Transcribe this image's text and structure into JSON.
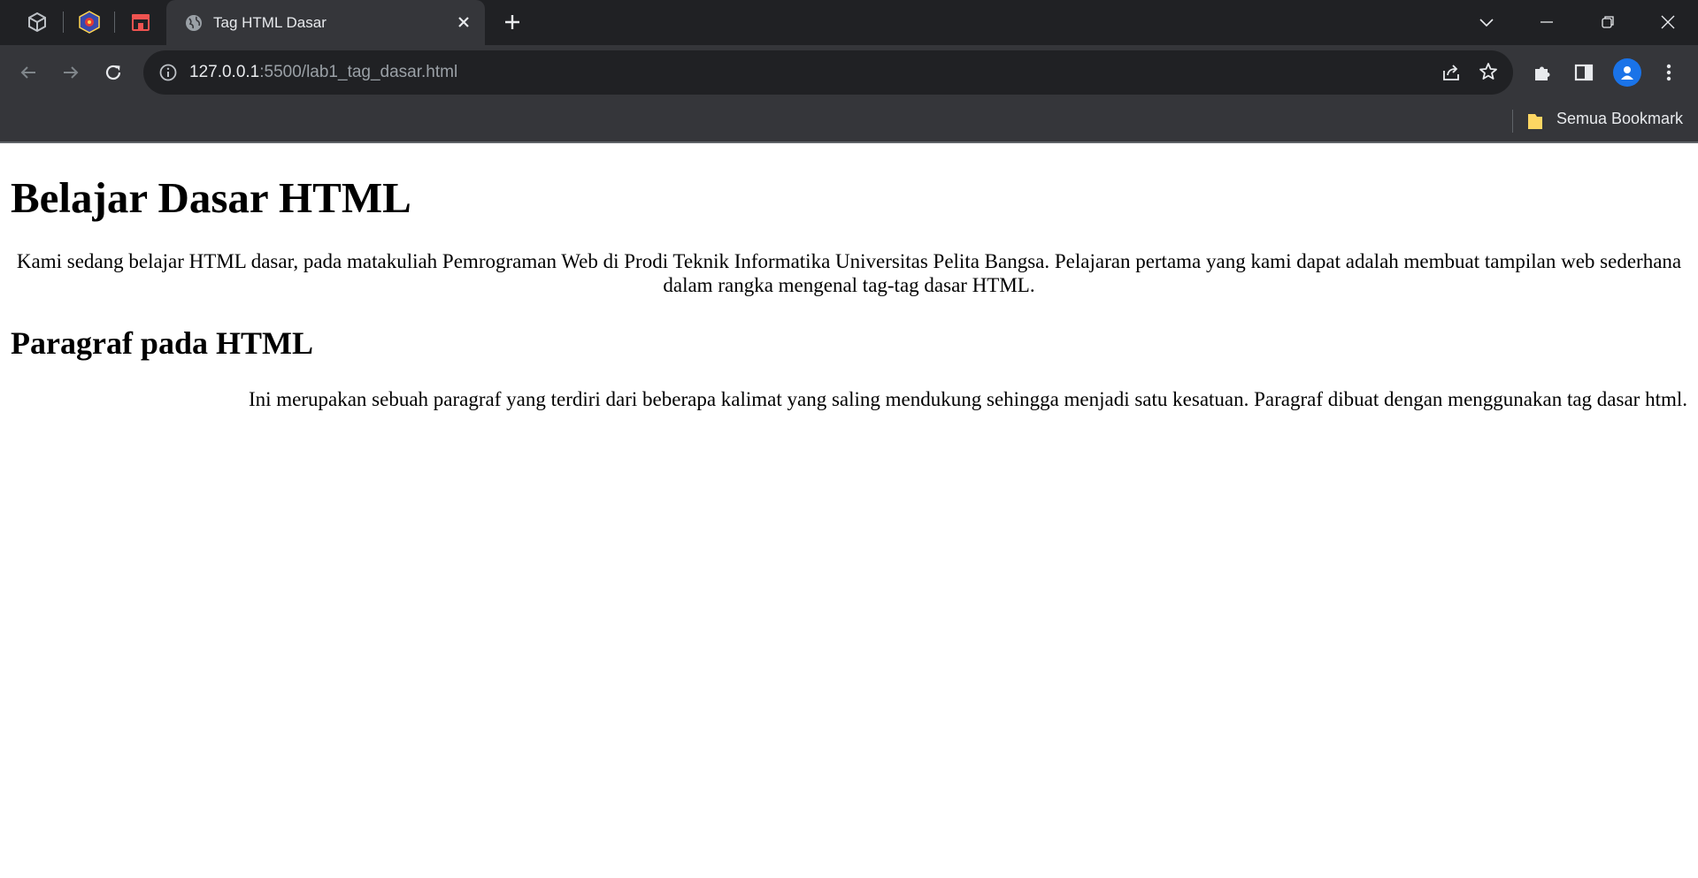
{
  "browser": {
    "pinned_tabs": [
      {
        "icon": "cube-icon"
      },
      {
        "icon": "university-crest-icon"
      },
      {
        "icon": "store-icon"
      }
    ],
    "active_tab": {
      "title": "Tag HTML Dasar",
      "icon": "globe-icon"
    },
    "address": {
      "host": "127.0.0.1",
      "rest": ":5500/lab1_tag_dasar.html"
    },
    "bookmarks": {
      "all_label": "Semua Bookmark"
    },
    "colors": {
      "frame": "#202124",
      "toolbar": "#35363a",
      "accent": "#1a73e8",
      "text": "#e8eaed"
    }
  },
  "page": {
    "heading": "Belajar Dasar HTML",
    "intro": "Kami sedang belajar HTML dasar, pada matakuliah Pemrograman Web di Prodi Teknik Informatika Universitas Pelita Bangsa. Pelajaran pertama yang kami dapat adalah membuat tampilan web sederhana dalam rangka mengenal tag-tag dasar HTML.",
    "subheading": "Paragraf pada HTML",
    "paragraph": "Ini merupakan sebuah paragraf yang terdiri dari beberapa kalimat yang saling mendukung sehingga menjadi satu kesatuan. Paragraf dibuat dengan menggunakan tag dasar html."
  }
}
